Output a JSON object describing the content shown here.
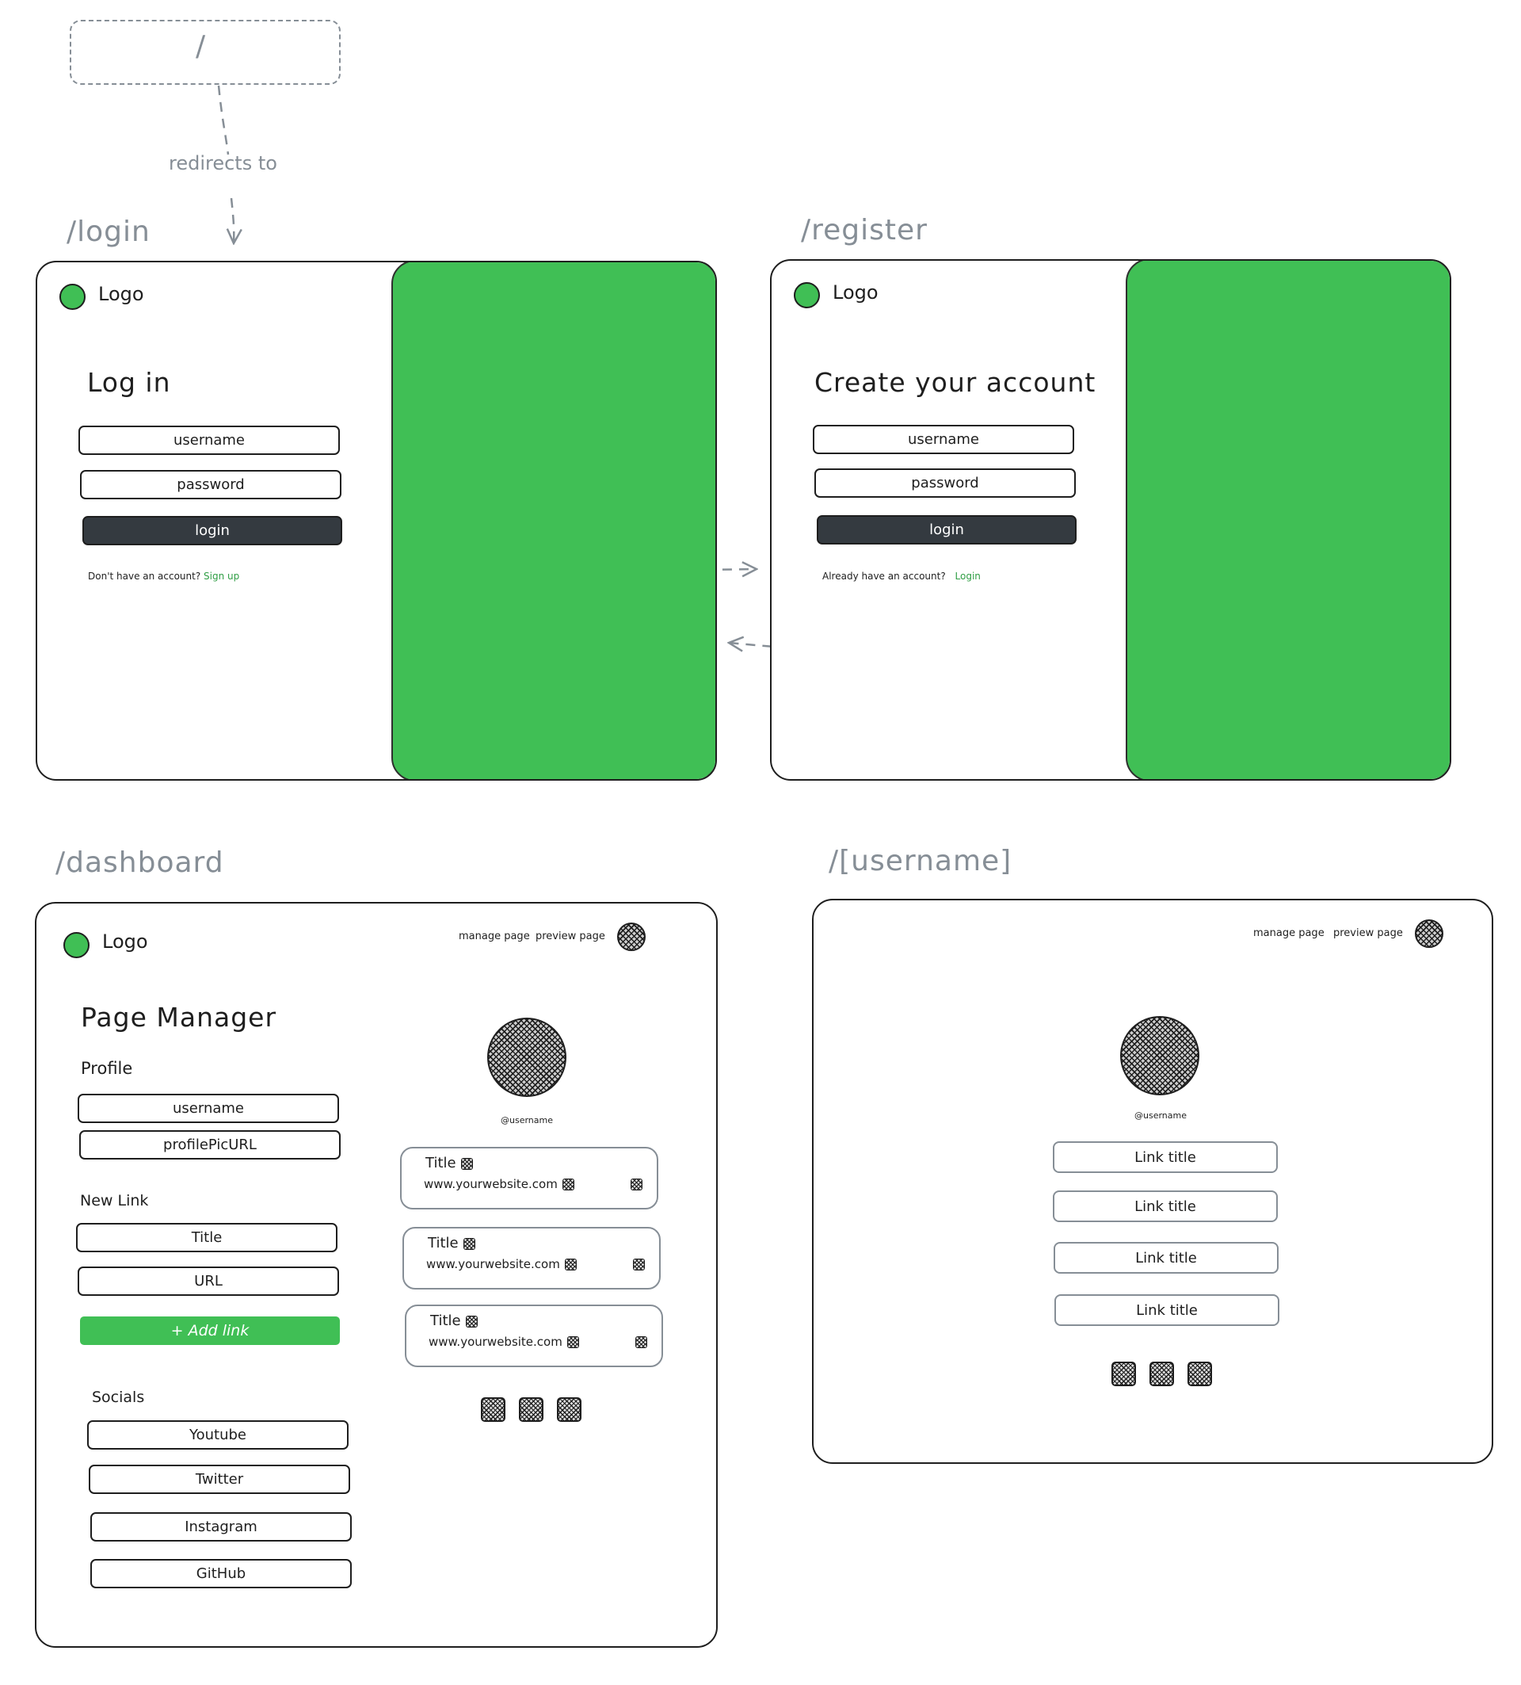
{
  "root": {
    "label": "/",
    "edge_label": "redirects to"
  },
  "login": {
    "route": "/login",
    "logo": "Logo",
    "heading": "Log in",
    "username": "username",
    "password": "password",
    "button": "login",
    "prompt": "Don't have an account?",
    "link": "Sign up"
  },
  "register": {
    "route": "/register",
    "logo": "Logo",
    "heading": "Create your account",
    "username": "username",
    "password": "password",
    "button": "login",
    "prompt": "Already have an account?",
    "link": "Login"
  },
  "dashboard": {
    "route": "/dashboard",
    "logo": "Logo",
    "nav": {
      "manage": "manage page",
      "preview": "preview page"
    },
    "heading": "Page Manager",
    "profile": {
      "label": "Profile",
      "username": "username",
      "pic": "profilePicURL"
    },
    "new_link": {
      "label": "New Link",
      "title": "Title",
      "url": "URL",
      "button": "+ Add link"
    },
    "socials": {
      "label": "Socials",
      "items": [
        "Youtube",
        "Twitter",
        "Instagram",
        "GitHub"
      ]
    },
    "preview": {
      "username": "@username",
      "cards": [
        {
          "title": "Title",
          "url": "www.yourwebsite.com"
        },
        {
          "title": "Title",
          "url": "www.yourwebsite.com"
        },
        {
          "title": "Title",
          "url": "www.yourwebsite.com"
        }
      ]
    }
  },
  "public": {
    "route": "/[username]",
    "nav": {
      "manage": "manage page",
      "preview": "preview page"
    },
    "username": "@username",
    "links": [
      "Link title",
      "Link title",
      "Link title",
      "Link title"
    ]
  },
  "colors": {
    "accent": "#40bf55",
    "dark": "#343a40",
    "stroke": "#1e1e1e",
    "muted": "#868e96",
    "link": "#2f9e44"
  }
}
